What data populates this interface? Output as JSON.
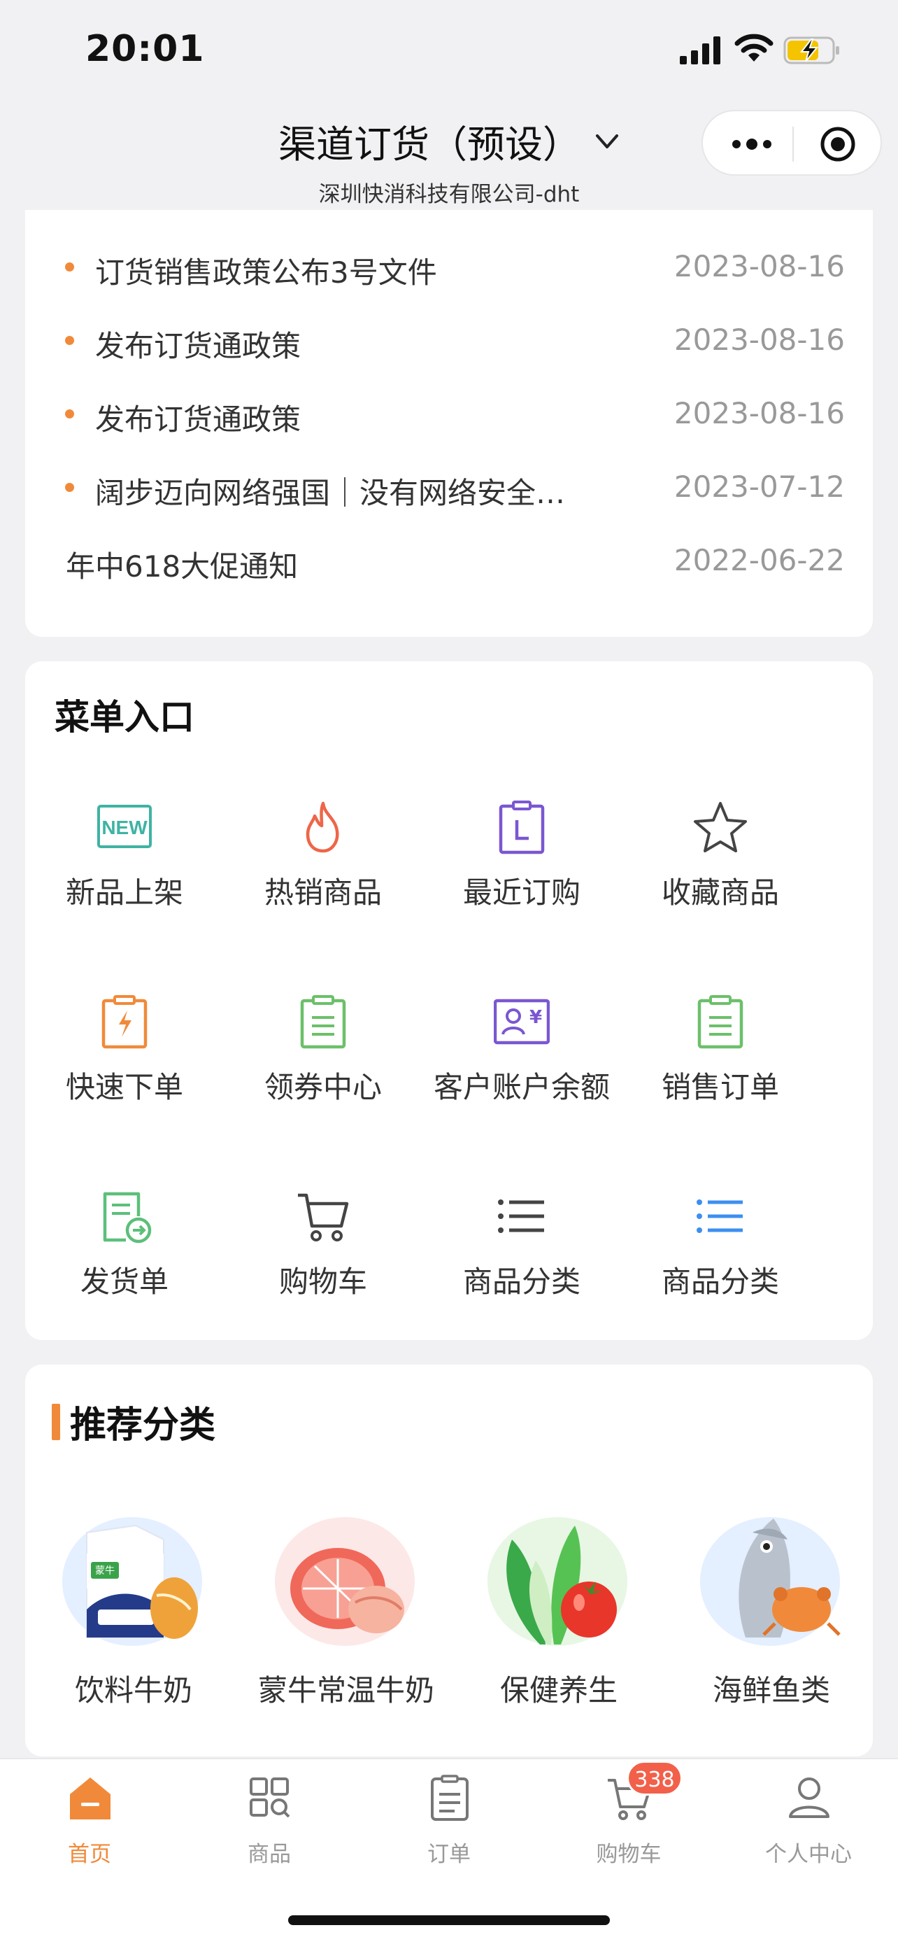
{
  "status_bar": {
    "time": "20:01"
  },
  "header": {
    "title": "渠道订货（预设）",
    "subtitle": "深圳快消科技有限公司-dht"
  },
  "news": [
    {
      "title": "订货销售政策公布3号文件",
      "date": "2023-08-16",
      "bullet": true
    },
    {
      "title": "发布订货通政策",
      "date": "2023-08-16",
      "bullet": true
    },
    {
      "title": "发布订货通政策",
      "date": "2023-08-16",
      "bullet": true
    },
    {
      "title": "阔步迈向网络强国｜没有网络安全…",
      "date": "2023-07-12",
      "bullet": true
    },
    {
      "title": "年中618大促通知",
      "date": "2022-06-22",
      "bullet": false
    }
  ],
  "menu": {
    "title": "菜单入口",
    "items": [
      {
        "label": "新品上架",
        "icon": "new-badge-icon"
      },
      {
        "label": "热销商品",
        "icon": "flame-icon"
      },
      {
        "label": "最近订购",
        "icon": "recent-order-icon"
      },
      {
        "label": "收藏商品",
        "icon": "star-icon"
      },
      {
        "label": "快速下单",
        "icon": "quick-order-icon"
      },
      {
        "label": "领券中心",
        "icon": "coupon-clipboard-icon"
      },
      {
        "label": "客户账户余额",
        "icon": "account-balance-icon"
      },
      {
        "label": "销售订单",
        "icon": "sales-order-icon"
      },
      {
        "label": "发货单",
        "icon": "delivery-note-icon"
      },
      {
        "label": "购物车",
        "icon": "cart-icon"
      },
      {
        "label": "商品分类",
        "icon": "list-icon"
      },
      {
        "label": "商品分类",
        "icon": "list-blue-icon"
      }
    ]
  },
  "recommend": {
    "title": "推荐分类",
    "items": [
      {
        "label": "饮料牛奶",
        "icon": "milk-carton-image",
        "image_text": "蒙牛"
      },
      {
        "label": "蒙牛常温牛奶",
        "icon": "grapefruit-image"
      },
      {
        "label": "保健养生",
        "icon": "vegetable-tomato-image"
      },
      {
        "label": "海鲜鱼类",
        "icon": "fish-crab-image"
      }
    ]
  },
  "tabbar": {
    "items": [
      {
        "label": "首页",
        "icon": "home-icon",
        "active": true
      },
      {
        "label": "商品",
        "icon": "grid-search-icon",
        "active": false
      },
      {
        "label": "订单",
        "icon": "order-list-icon",
        "active": false
      },
      {
        "label": "购物车",
        "icon": "cart-icon",
        "active": false
      },
      {
        "label": "个人中心",
        "icon": "user-icon",
        "active": false
      }
    ],
    "cart_badge": "338"
  },
  "colors": {
    "accent": "#f08a3a",
    "badge": "#f2604a",
    "teal": "#3fb3a3",
    "purple": "#7a57d1",
    "green": "#6cc06a",
    "blue": "#3d8ff0"
  }
}
